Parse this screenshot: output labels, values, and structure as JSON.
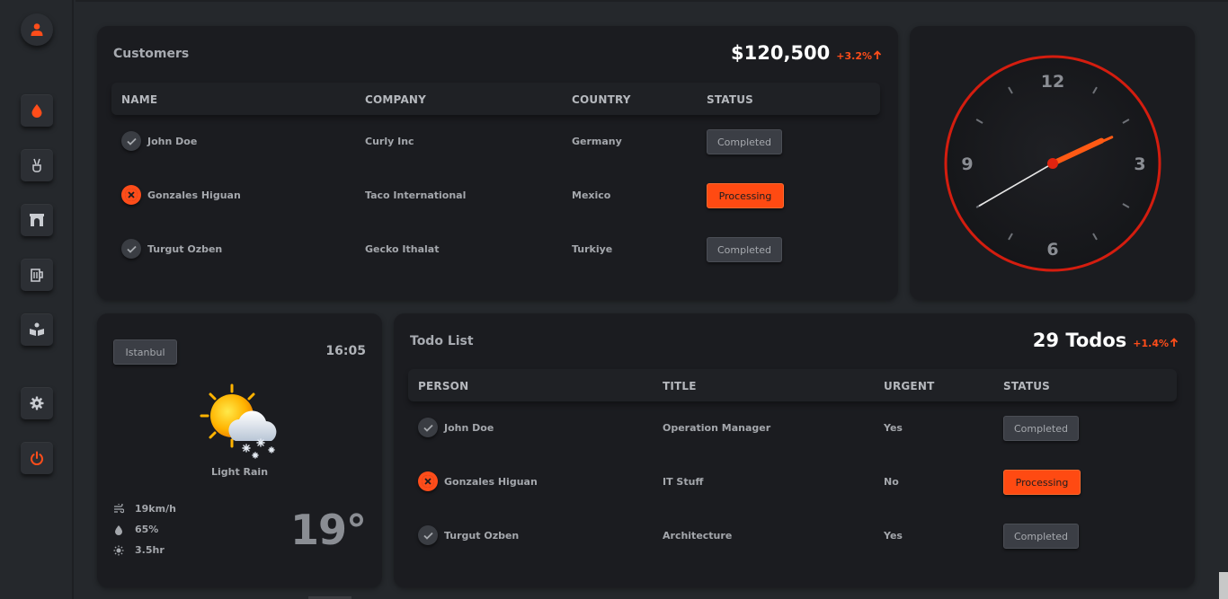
{
  "sidebar": {
    "items": [
      {
        "icon": "user-icon"
      },
      {
        "icon": "drop-icon"
      },
      {
        "icon": "hand-peace-icon"
      },
      {
        "icon": "archway-icon"
      },
      {
        "icon": "beer-mug-icon"
      },
      {
        "icon": "book-reader-icon"
      },
      {
        "icon": "gear-icon"
      },
      {
        "icon": "power-icon"
      }
    ],
    "accent": "#ff4d1a"
  },
  "customers": {
    "title": "Customers",
    "total": "$120,500",
    "delta": "+3.2%",
    "columns": [
      "NAME",
      "COMPANY",
      "COUNTRY",
      "STATUS"
    ],
    "rows": [
      {
        "name": "John Doe",
        "company": "Curly Inc",
        "country": "Germany",
        "status": "Completed",
        "ok": true
      },
      {
        "name": "Gonzales Higuan",
        "company": "Taco International",
        "country": "Mexico",
        "status": "Processing",
        "ok": false
      },
      {
        "name": "Turgut Ozben",
        "company": "Gecko Ithalat",
        "country": "Turkiye",
        "status": "Completed",
        "ok": true
      }
    ]
  },
  "clock": {
    "numerals": [
      "12",
      "3",
      "6",
      "9"
    ],
    "hour": 2,
    "minute": 10,
    "second": 40
  },
  "weather": {
    "city": "Istanbul",
    "time": "16:05",
    "condition": "Light Rain",
    "wind": "19km/h",
    "humidity": "65%",
    "sun": "3.5hr",
    "temperature": "19°"
  },
  "todos": {
    "title": "Todo List",
    "total": "29 Todos",
    "delta": "+1.4%",
    "columns": [
      "PERSON",
      "TITLE",
      "URGENT",
      "STATUS"
    ],
    "rows": [
      {
        "person": "John Doe",
        "title": "Operation Manager",
        "urgent": "Yes",
        "status": "Completed",
        "ok": true
      },
      {
        "person": "Gonzales Higuan",
        "title": "IT Stuff",
        "urgent": "No",
        "status": "Processing",
        "ok": false
      },
      {
        "person": "Turgut Ozben",
        "title": "Architecture",
        "urgent": "Yes",
        "status": "Completed",
        "ok": true
      }
    ]
  },
  "colors": {
    "accent": "#ff4d1a",
    "card": "#1b1c20",
    "background": "#25282c"
  }
}
